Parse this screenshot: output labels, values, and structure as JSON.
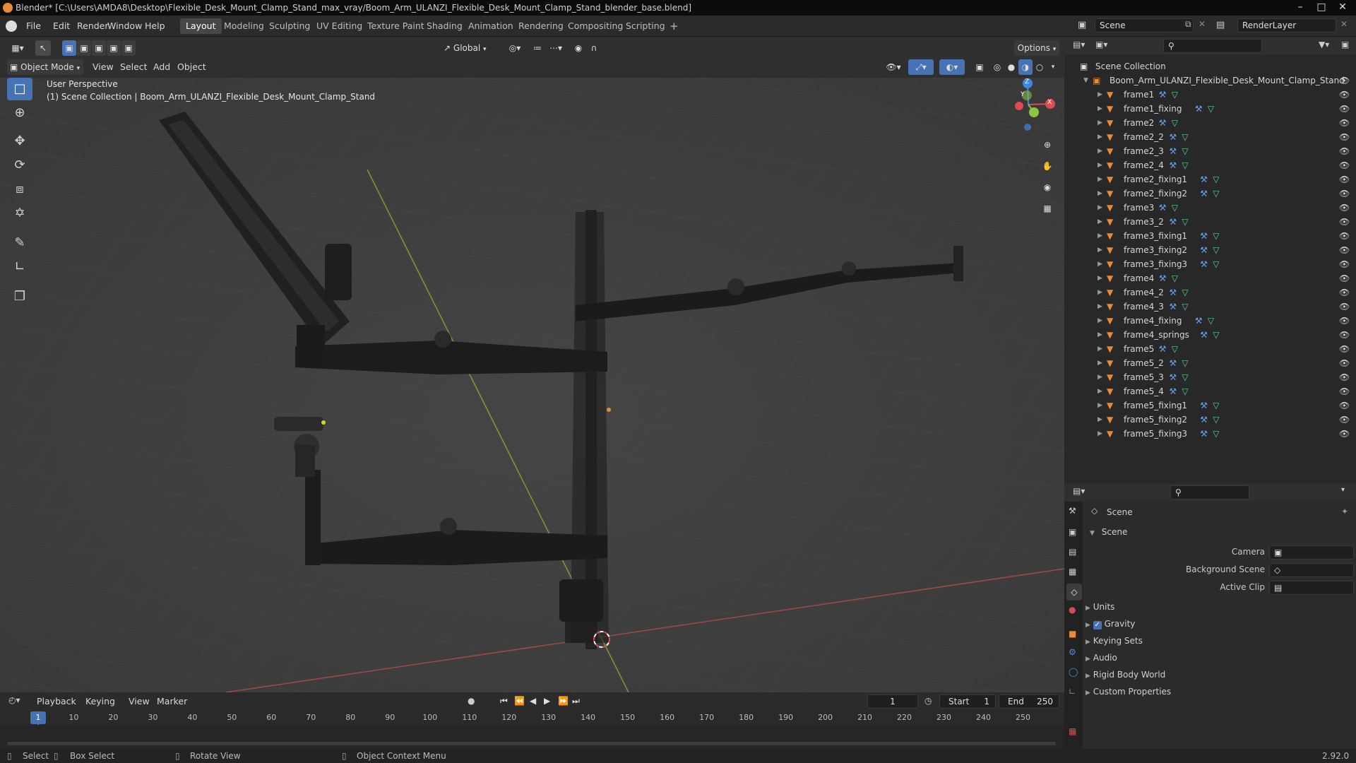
{
  "title_bar": {
    "text": "Blender* [C:\\Users\\AMDA8\\Desktop\\Flexible_Desk_Mount_Clamp_Stand_max_vray/Boom_Arm_ULANZI_Flexible_Desk_Mount_Clamp_Stand_blender_base.blend]"
  },
  "menus": [
    "File",
    "Edit",
    "Render",
    "Window",
    "Help"
  ],
  "workspaces": [
    "Layout",
    "Modeling",
    "Sculpting",
    "UV Editing",
    "Texture Paint",
    "Shading",
    "Animation",
    "Rendering",
    "Compositing",
    "Scripting"
  ],
  "active_workspace": "Layout",
  "scene_selector": {
    "value": "Scene"
  },
  "render_layer": {
    "value": "RenderLayer"
  },
  "viewport_header": {
    "transform_orientation": "Global",
    "options_label": "Options",
    "mode": "Object Mode",
    "menus": [
      "View",
      "Select",
      "Add",
      "Object"
    ]
  },
  "viewport": {
    "perspective_label": "User Perspective",
    "collection_label": "(1) Scene Collection | Boom_Arm_ULANZI_Flexible_Desk_Mount_Clamp_Stand",
    "gizmo": {
      "x": "X",
      "y": "Y",
      "z": "Z"
    }
  },
  "outliner": {
    "root": "Scene Collection",
    "collection": "Boom_Arm_ULANZI_Flexible_Desk_Mount_Clamp_Stand",
    "objects": [
      "frame1",
      "frame1_fixing",
      "frame2",
      "frame2_2",
      "frame2_3",
      "frame2_4",
      "frame2_fixing1",
      "frame2_fixing2",
      "frame3",
      "frame3_2",
      "frame3_fixing1",
      "frame3_fixing2",
      "frame3_fixing3",
      "frame4",
      "frame4_2",
      "frame4_3",
      "frame4_fixing",
      "frame4_springs",
      "frame5",
      "frame5_2",
      "frame5_3",
      "frame5_4",
      "frame5_fixing1",
      "frame5_fixing2",
      "frame5_fixing3"
    ]
  },
  "properties": {
    "context": "Scene",
    "panel_title": "Scene",
    "fields": [
      {
        "label": "Camera",
        "value": ""
      },
      {
        "label": "Background Scene",
        "value": ""
      },
      {
        "label": "Active Clip",
        "value": ""
      }
    ],
    "sections": [
      "Units",
      "Gravity",
      "Keying Sets",
      "Audio",
      "Rigid Body World",
      "Custom Properties"
    ],
    "gravity_checked": true
  },
  "timeline": {
    "menus": [
      "Playback",
      "Keying",
      "View",
      "Marker"
    ],
    "current_frame": "1",
    "start_label": "Start",
    "start": "1",
    "end_label": "End",
    "end": "250",
    "ticks": [
      "1",
      "10",
      "20",
      "30",
      "40",
      "50",
      "60",
      "70",
      "80",
      "90",
      "100",
      "110",
      "120",
      "130",
      "140",
      "150",
      "160",
      "170",
      "180",
      "190",
      "200",
      "210",
      "220",
      "230",
      "240",
      "250"
    ]
  },
  "status_bar": {
    "items": [
      "Select",
      "Box Select",
      "Rotate View",
      "Object Context Menu"
    ],
    "version": "2.92.0"
  },
  "colors": {
    "accent": "#4772b3",
    "object_icon": "#e98a36",
    "x_axis": "#e04a50",
    "y_axis": "#8ec63f",
    "z_axis": "#3f86e0"
  }
}
